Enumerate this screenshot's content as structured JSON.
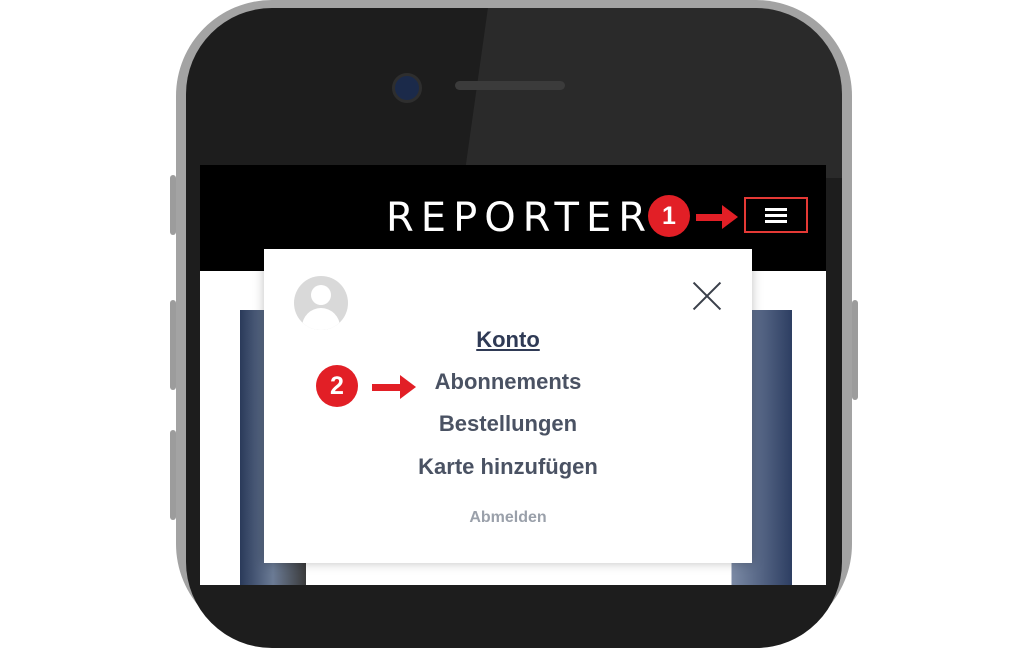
{
  "header": {
    "brand": "REPORTER"
  },
  "callouts": {
    "step1": "1",
    "step2": "2"
  },
  "account_menu": {
    "items": [
      {
        "label": "Konto",
        "active": true
      },
      {
        "label": "Abonnements",
        "active": false
      },
      {
        "label": "Bestellungen",
        "active": false
      },
      {
        "label": "Karte hinzufügen",
        "active": false
      }
    ],
    "logout_label": "Abmelden"
  },
  "icons": {
    "menu": "hamburger-icon",
    "close": "close-icon",
    "avatar": "user-avatar-icon",
    "arrow": "arrow-right-icon"
  },
  "colors": {
    "accent": "#e21f26",
    "header_bg": "#000000",
    "menu_text": "#4a5263"
  }
}
